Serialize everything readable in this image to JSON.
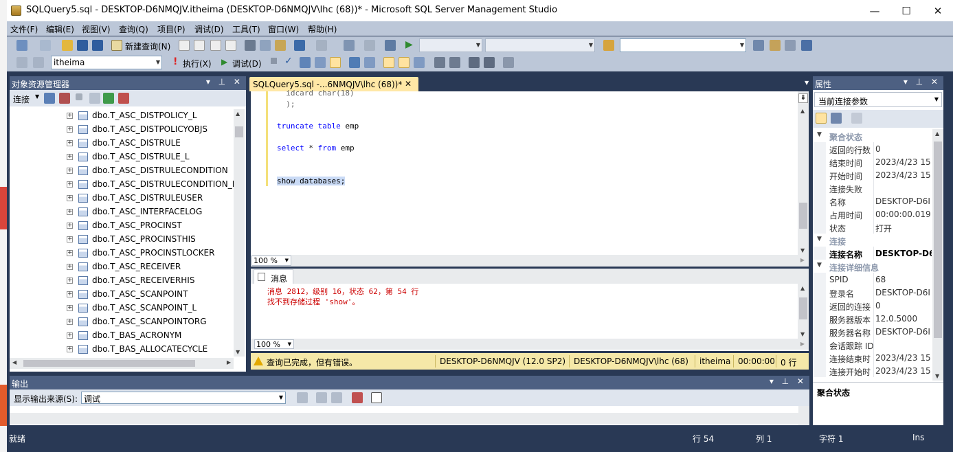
{
  "window": {
    "title": "SQLQuery5.sql - DESKTOP-D6NMQJV.itheima (DESKTOP-D6NMQJV\\lhc (68))* - Microsoft SQL Server Management Studio",
    "minimize": "—",
    "maximize": "☐",
    "close": "✕"
  },
  "menu": [
    "文件(F)",
    "编辑(E)",
    "视图(V)",
    "查询(Q)",
    "项目(P)",
    "调试(D)",
    "工具(T)",
    "窗口(W)",
    "帮助(H)"
  ],
  "toolbar": {
    "new_query": "新建查询(N)",
    "execute": "执行(X)",
    "debug": "调试(D)",
    "database": "itheima"
  },
  "object_explorer": {
    "title": "对象资源管理器",
    "connect": "连接",
    "items": [
      "dbo.T_ASC_DISTPOLICY_L",
      "dbo.T_ASC_DISTPOLICYOBJS",
      "dbo.T_ASC_DISTRULE",
      "dbo.T_ASC_DISTRULE_L",
      "dbo.T_ASC_DISTRULECONDITION",
      "dbo.T_ASC_DISTRULECONDITION_L",
      "dbo.T_ASC_DISTRULEUSER",
      "dbo.T_ASC_INTERFACELOG",
      "dbo.T_ASC_PROCINST",
      "dbo.T_ASC_PROCINSTHIS",
      "dbo.T_ASC_PROCINSTLOCKER",
      "dbo.T_ASC_RECEIVER",
      "dbo.T_ASC_RECEIVERHIS",
      "dbo.T_ASC_SCANPOINT",
      "dbo.T_ASC_SCANPOINT_L",
      "dbo.T_ASC_SCANPOINTORG",
      "dbo.T_BAS_ACRONYM",
      "dbo.T_BAS_ALLOCATECYCLE"
    ]
  },
  "editor": {
    "tab": "SQLQuery5.sql -...6NMQJV\\lhc (68))*",
    "lines": [
      "  idcard char(18)",
      "  );",
      "",
      "truncate table emp",
      "",
      "select * from emp",
      "",
      "",
      "show databases;"
    ],
    "zoom": "100 %"
  },
  "messages": {
    "tab": "消息",
    "line1": "消息 2812，级别 16，状态 62，第 54 行",
    "line2": "找不到存储过程 'show'。",
    "zoom": "100 %"
  },
  "query_status": {
    "text": "查询已完成，但有错误。",
    "server": "DESKTOP-D6NMQJV (12.0 SP2)",
    "login": "DESKTOP-D6NMQJV\\lhc (68)",
    "db": "itheima",
    "time": "00:00:00",
    "rows": "0 行"
  },
  "properties": {
    "title": "属性",
    "selector": "当前连接参数",
    "rows": [
      {
        "type": "cat",
        "k": "聚合状态"
      },
      {
        "k": "返回的行数",
        "v": "0"
      },
      {
        "k": "结束时间",
        "v": "2023/4/23 15"
      },
      {
        "k": "开始时间",
        "v": "2023/4/23 15"
      },
      {
        "k": "连接失败",
        "v": ""
      },
      {
        "k": "名称",
        "v": "DESKTOP-D6I"
      },
      {
        "k": "占用时间",
        "v": "00:00:00.019"
      },
      {
        "k": "状态",
        "v": "打开"
      },
      {
        "type": "cat",
        "k": "连接"
      },
      {
        "k": "连接名称",
        "v": "DESKTOP-D6I",
        "bold": true
      },
      {
        "type": "cat",
        "k": "连接详细信息"
      },
      {
        "k": "SPID",
        "v": "68"
      },
      {
        "k": "登录名",
        "v": "DESKTOP-D6I"
      },
      {
        "k": "返回的连接",
        "v": "0"
      },
      {
        "k": "服务器版本",
        "v": "12.0.5000"
      },
      {
        "k": "服务器名称",
        "v": "DESKTOP-D6I"
      },
      {
        "k": "会话跟踪 ID",
        "v": ""
      },
      {
        "k": "连接结束时",
        "v": "2023/4/23 15"
      },
      {
        "k": "连接开始时",
        "v": "2023/4/23 15"
      }
    ],
    "desc_title": "聚合状态"
  },
  "output": {
    "title": "输出",
    "source_label": "显示输出来源(S):",
    "source_value": "调试"
  },
  "statusbar": {
    "ready": "就绪",
    "line": "行 54",
    "col": "列 1",
    "ch": "字符 1",
    "mode": "Ins"
  },
  "colors": {
    "frame": "#293955",
    "toolbar": "#bcc7d8",
    "panel_header": "#4d6082",
    "active_tab": "#ffe8a6",
    "status_yellow": "#f5e8a8",
    "keyword": "#0000ff",
    "error": "#cc0000"
  }
}
